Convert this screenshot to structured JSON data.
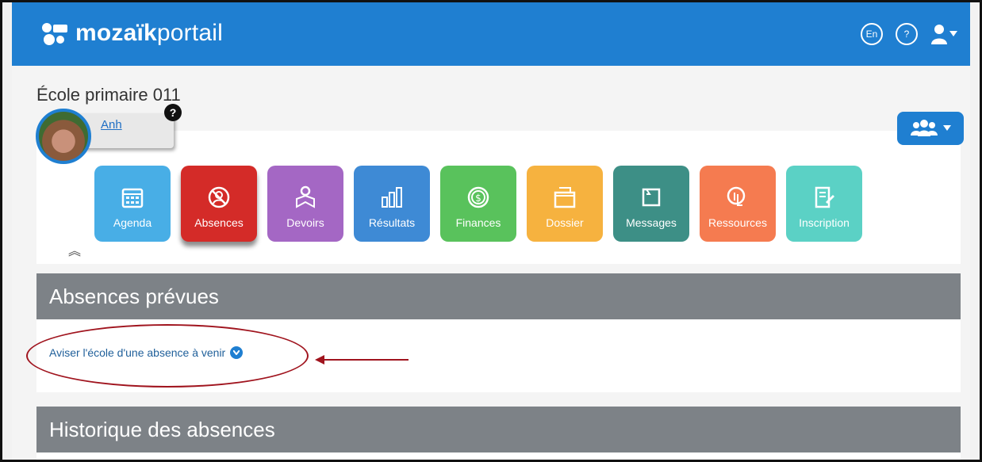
{
  "header": {
    "logo_bold": "mozaïk",
    "logo_light": "portail",
    "lang_button": "En",
    "help_button": "?"
  },
  "student": {
    "school": "École primaire 011",
    "name": "Anh",
    "help_badge": "?"
  },
  "tiles": [
    {
      "label": "Agenda",
      "color": "#48aee6",
      "icon": "calendar-icon"
    },
    {
      "label": "Absences",
      "color": "#d42b28",
      "icon": "absences-icon",
      "active": true
    },
    {
      "label": "Devoirs",
      "color": "#a467c4",
      "icon": "homework-icon"
    },
    {
      "label": "Résultats",
      "color": "#3e8ad5",
      "icon": "results-chart-icon"
    },
    {
      "label": "Finances",
      "color": "#59c25c",
      "icon": "money-icon"
    },
    {
      "label": "Dossier",
      "color": "#f6b23f",
      "icon": "folder-icon"
    },
    {
      "label": "Messages",
      "color": "#3d8f86",
      "icon": "messages-icon"
    },
    {
      "label": "Ressources",
      "color": "#f57b50",
      "icon": "resources-icon"
    },
    {
      "label": "Inscription",
      "color": "#5bd1c5",
      "icon": "registration-icon"
    }
  ],
  "sections": {
    "planned_title": "Absences prévues",
    "notify_link": "Aviser l'école d'une absence à venir",
    "history_title": "Historique des absences"
  },
  "colors": {
    "brand_blue": "#1f7fd1",
    "section_grey": "#7d8287",
    "annotation_red": "#a0141e"
  }
}
